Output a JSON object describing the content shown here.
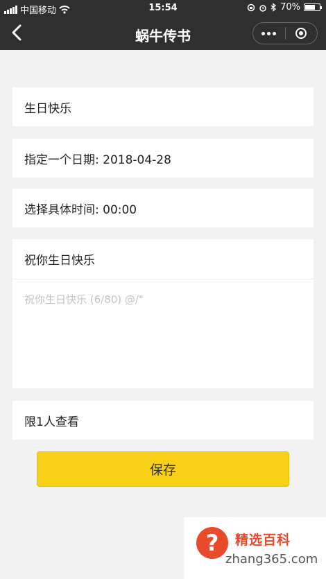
{
  "status_bar": {
    "carrier": "中国移动",
    "time": "15:54",
    "battery": "70%",
    "battery_level": 0.7
  },
  "nav": {
    "title": "蜗牛传书"
  },
  "form": {
    "greeting": "生日快乐",
    "date_label": "指定一个日期: 2018-04-28",
    "time_label": "选择具体时间: 00:00",
    "message_title": "祝你生日快乐",
    "message_placeholder": "祝你生日快乐 (6/80) @/\"",
    "visibility": "限1人查看",
    "save_label": "保存"
  },
  "watermark": {
    "brand": "精选百科",
    "domain": "zhang365.com",
    "icon_char": "?"
  }
}
